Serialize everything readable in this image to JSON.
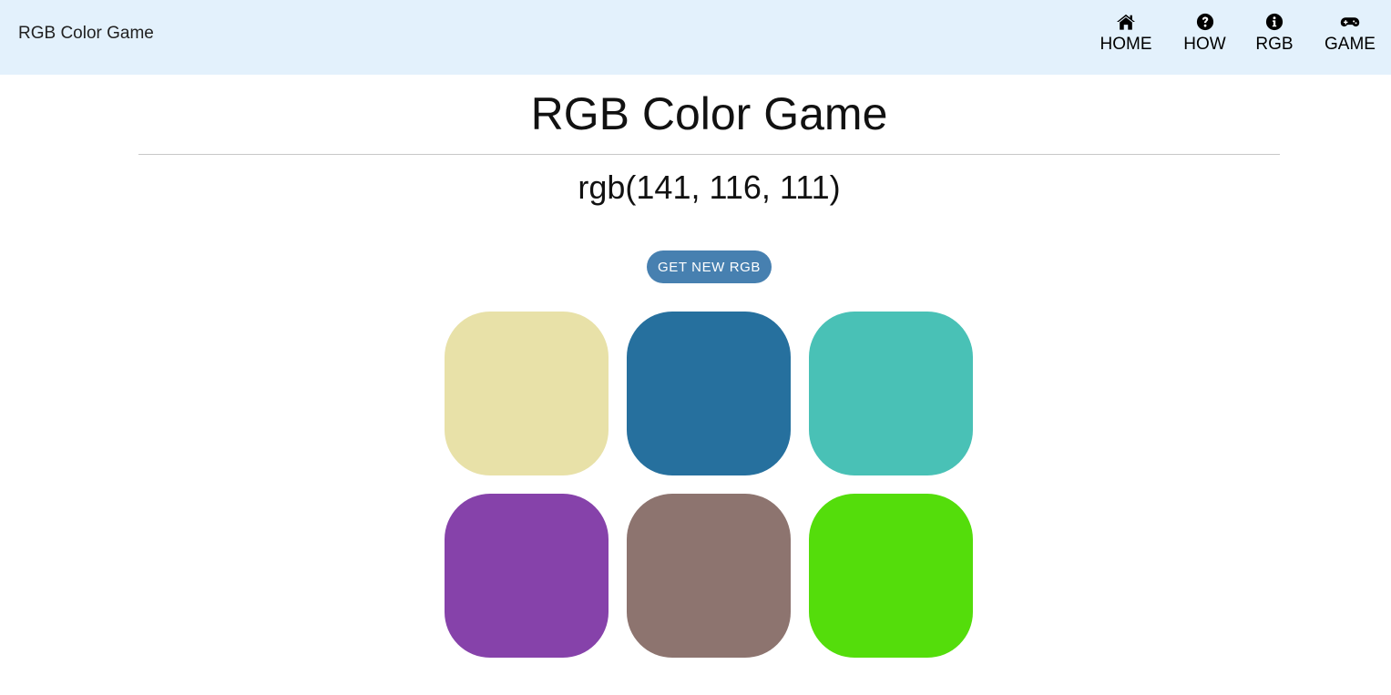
{
  "header": {
    "brand": "RGB Color Game",
    "nav": [
      {
        "label": "HOME",
        "icon": "home-icon"
      },
      {
        "label": "HOW",
        "icon": "question-circle-icon"
      },
      {
        "label": "RGB",
        "icon": "info-circle-icon"
      },
      {
        "label": "GAME",
        "icon": "gamepad-icon"
      }
    ],
    "background": "#e3f1fc"
  },
  "main": {
    "title": "RGB Color Game",
    "target_rgb": "rgb(141, 116, 111)",
    "new_button_label": "GET NEW RGB",
    "button_color": "#4780b0",
    "swatches": [
      {
        "color": "#e8e1a8"
      },
      {
        "color": "#26709e"
      },
      {
        "color": "#49c1b6"
      },
      {
        "color": "#8642aa"
      },
      {
        "color": "#8d746f"
      },
      {
        "color": "#54dd0b"
      }
    ]
  }
}
